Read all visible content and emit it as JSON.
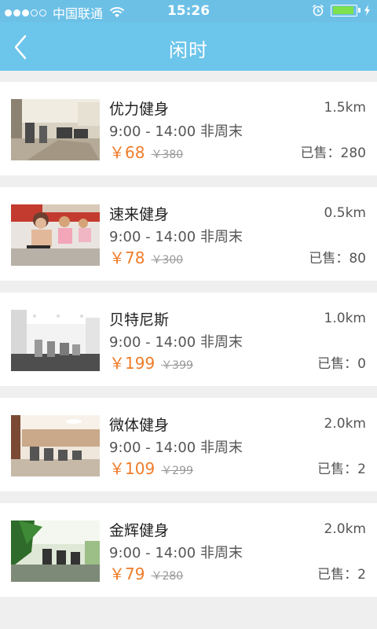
{
  "status": {
    "carrier": "中国联通",
    "time": "15:26"
  },
  "nav": {
    "title": "闲时"
  },
  "gyms": [
    {
      "name": "优力健身",
      "hours": "9:00 - 14:00  非周末",
      "price": "￥68",
      "old_price": "￥380",
      "distance": "1.5km",
      "sold": "已售：280"
    },
    {
      "name": "速来健身",
      "hours": "9:00 - 14:00  非周末",
      "price": "￥78",
      "old_price": "￥300",
      "distance": "0.5km",
      "sold": "已售：80"
    },
    {
      "name": "贝特尼斯",
      "hours": "9:00 - 14:00  非周末",
      "price": "￥199",
      "old_price": "￥399",
      "distance": "1.0km",
      "sold": "已售：0"
    },
    {
      "name": "微体健身",
      "hours": "9:00 - 14:00  非周末",
      "price": "￥109",
      "old_price": "￥299",
      "distance": "2.0km",
      "sold": "已售：2"
    },
    {
      "name": "金辉健身",
      "hours": "9:00 - 14:00  非周末",
      "price": "￥79",
      "old_price": "￥280",
      "distance": "2.0km",
      "sold": "已售：2"
    }
  ],
  "colors": {
    "nav_bg": "#6cc5ea",
    "price": "#f07c2a"
  }
}
